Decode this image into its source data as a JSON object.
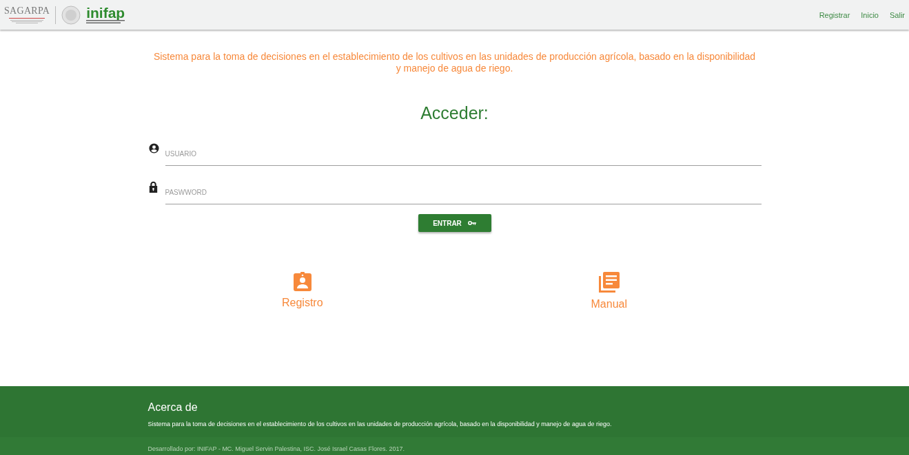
{
  "header": {
    "logos": {
      "sagarpa": "SAGARPA",
      "inifap": "inifap"
    },
    "nav": [
      "Registrar",
      "Inicio",
      "Salir"
    ]
  },
  "intro": "Sistema para la toma de decisiones en el establecimiento de los cultivos en las unidades de producción agrícola, basado en la disponibilidad y manejo de agua de riego.",
  "login": {
    "title": "Acceder:",
    "fields": [
      {
        "kind": "user",
        "placeholder": "USUARIO"
      },
      {
        "kind": "password",
        "placeholder": "PASWWORD"
      }
    ],
    "button": "ENTRAR"
  },
  "links": [
    {
      "kind": "registro",
      "label": "Registro"
    },
    {
      "kind": "manual",
      "label": "Manual"
    }
  ],
  "footer": {
    "title": "Acerca de",
    "text": "Sistema para la toma de decisiones en el establecimiento de los cultivos en las unidades de producción agrícola, basado en la disponibilidad y manejo de agua de riego.",
    "credits": "Desarrollado por: INIFAP - MC. Miguel Servin Palestina, ISC. José Israel Casas Flores. 2017."
  }
}
